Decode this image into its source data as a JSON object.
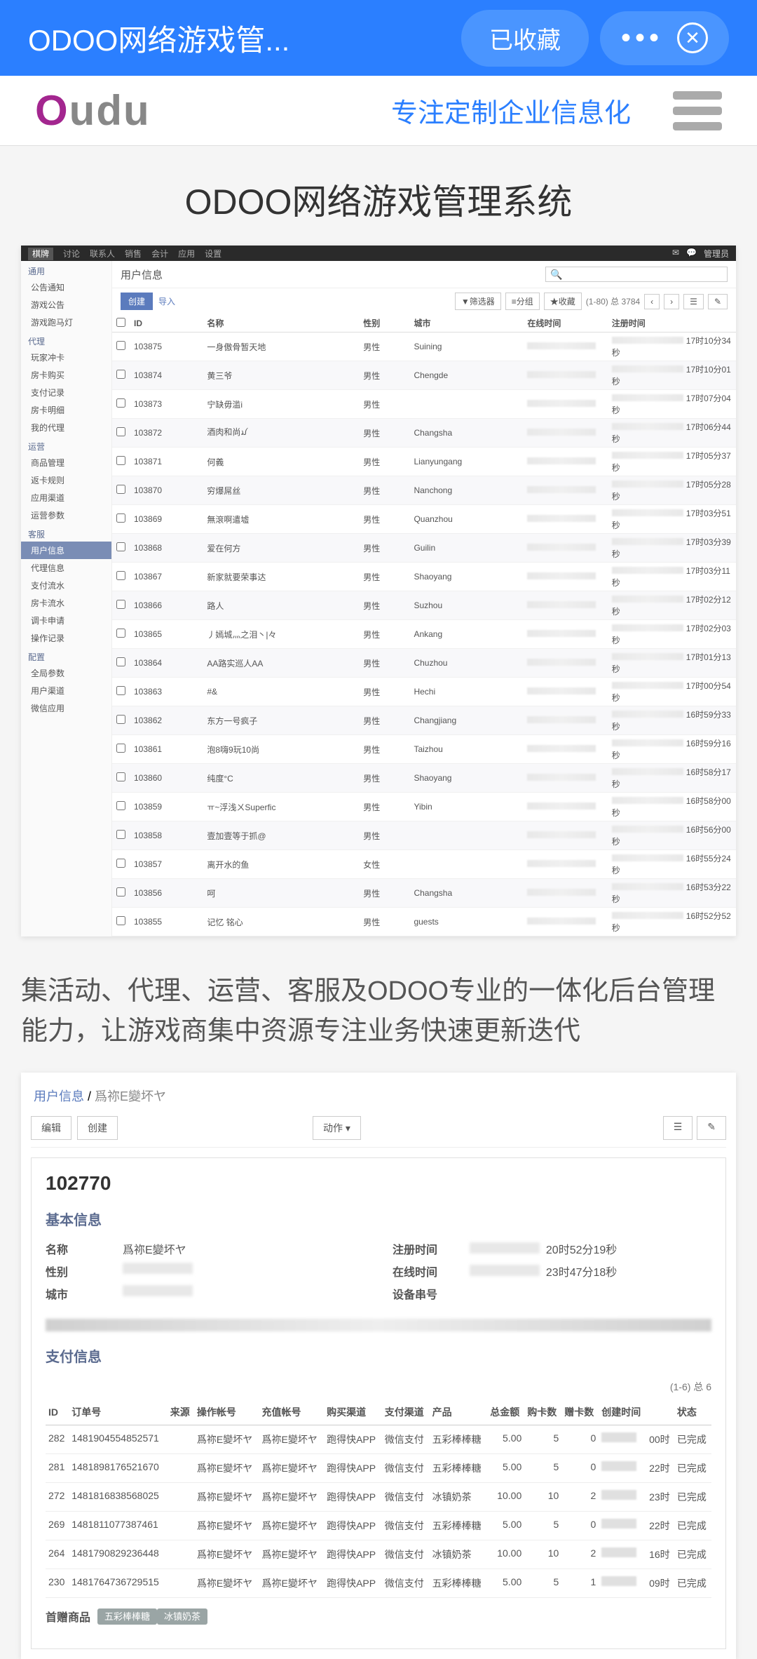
{
  "topbar": {
    "title": "ODOO网络游戏管...",
    "fav": "已收藏"
  },
  "header": {
    "logo1": "O",
    "logo2": "udu",
    "tagline": "专注定制企业信息化"
  },
  "bigTitle": "ODOO网络游戏管理系统",
  "nav": {
    "items": [
      "棋牌",
      "讨论",
      "联系人",
      "销售",
      "会计",
      "应用",
      "设置"
    ],
    "admin": "管理员"
  },
  "sidebar": {
    "groups": [
      {
        "title": "通用",
        "items": [
          "公告通知",
          "游戏公告",
          "游戏跑马灯"
        ]
      },
      {
        "title": "代理",
        "items": [
          "玩家冲卡",
          "房卡购买",
          "支付记录",
          "房卡明细",
          "我的代理"
        ]
      },
      {
        "title": "运营",
        "items": [
          "商品管理",
          "返卡规则",
          "应用渠道",
          "运营参数"
        ]
      },
      {
        "title": "客服",
        "items": [
          "用户信息",
          "代理信息",
          "支付流水",
          "房卡流水",
          "调卡申请",
          "操作记录"
        ]
      },
      {
        "title": "配置",
        "items": [
          "全局参数",
          "用户渠道",
          "微信应用"
        ]
      }
    ],
    "activeItem": "用户信息"
  },
  "listHeader": {
    "breadcrumb": "用户信息",
    "createBtn": "创建",
    "importBtn": "导入",
    "filterBtn": "▼筛选器",
    "groupBtn": "≡分组",
    "favBtn": "★收藏",
    "pager": "(1-80) 总 3784"
  },
  "tableCols": [
    "ID",
    "名称",
    "性别",
    "城市",
    "在线时间",
    "注册时间"
  ],
  "rows": [
    {
      "id": "103875",
      "name": "一身傲骨暂天地",
      "sex": "男性",
      "city": "Suining",
      "reg": "17时10分34秒"
    },
    {
      "id": "103874",
      "name": "黄三爷",
      "sex": "男性",
      "city": "Chengde",
      "reg": "17时10分01秒"
    },
    {
      "id": "103873",
      "name": "宁缺毋滥i",
      "sex": "男性",
      "city": "",
      "reg": "17时07分04秒"
    },
    {
      "id": "103872",
      "name": "酒肉和尚ꪣ",
      "sex": "男性",
      "city": "Changsha",
      "reg": "17时06分44秒"
    },
    {
      "id": "103871",
      "name": "何義",
      "sex": "男性",
      "city": "Lianyungang",
      "reg": "17时05分37秒"
    },
    {
      "id": "103870",
      "name": "穷爆屌丝",
      "sex": "男性",
      "city": "Nanchong",
      "reg": "17时05分28秒"
    },
    {
      "id": "103869",
      "name": "無滾啊遣墟",
      "sex": "男性",
      "city": "Quanzhou",
      "reg": "17时03分51秒"
    },
    {
      "id": "103868",
      "name": "爱在何方",
      "sex": "男性",
      "city": "Guilin",
      "reg": "17时03分39秒"
    },
    {
      "id": "103867",
      "name": "新家就要荣事达",
      "sex": "男性",
      "city": "Shaoyang",
      "reg": "17时03分11秒"
    },
    {
      "id": "103866",
      "name": "路人",
      "sex": "男性",
      "city": "Suzhou",
      "reg": "17时02分12秒"
    },
    {
      "id": "103865",
      "name": "丿嫣城灬之泪丶|々",
      "sex": "男性",
      "city": "Ankang",
      "reg": "17时02分03秒"
    },
    {
      "id": "103864",
      "name": "AA路实巡人AA",
      "sex": "男性",
      "city": "Chuzhou",
      "reg": "17时01分13秒"
    },
    {
      "id": "103863",
      "name": "#&",
      "sex": "男性",
      "city": "Hechi",
      "reg": "17时00分54秒"
    },
    {
      "id": "103862",
      "name": "东方一号疯子",
      "sex": "男性",
      "city": "Changjiang",
      "reg": "16时59分33秒"
    },
    {
      "id": "103861",
      "name": "泡8嗨9玩10尚",
      "sex": "男性",
      "city": "Taizhou",
      "reg": "16时59分16秒"
    },
    {
      "id": "103860",
      "name": "纯度°C",
      "sex": "男性",
      "city": "Shaoyang",
      "reg": "16时58分17秒"
    },
    {
      "id": "103859",
      "name": "ㅠ~浮浅ㄨSuperfic",
      "sex": "男性",
      "city": "Yibin",
      "reg": "16时58分00秒"
    },
    {
      "id": "103858",
      "name": "壹加壹等于抓@",
      "sex": "男性",
      "city": "",
      "reg": "16时56分00秒"
    },
    {
      "id": "103857",
      "name": "离开水的鱼",
      "sex": "女性",
      "city": "",
      "reg": "16时55分24秒"
    },
    {
      "id": "103856",
      "name": "呵",
      "sex": "男性",
      "city": "Changsha",
      "reg": "16时53分22秒"
    },
    {
      "id": "103855",
      "name": "记忆 铭心",
      "sex": "男性",
      "city": "guests",
      "reg": "16时52分52秒"
    }
  ],
  "desc": "集活动、代理、运营、客服及ODOO专业的一体化后台管理能力，让游戏商集中资源专注业务快速更新迭代",
  "detail": {
    "bcLink": "用户信息",
    "bcName": "爲祢E變坏ヤ",
    "editBtn": "编辑",
    "createBtn": "创建",
    "actionBtn": "动作",
    "recordId": "102770",
    "basicTitle": "基本信息",
    "labels": {
      "name": "名称",
      "sex": "性别",
      "city": "城市",
      "regTime": "注册时间",
      "onlineTime": "在线时间",
      "deviceId": "设备串号"
    },
    "vals": {
      "name": "爲祢E變坏ヤ",
      "regTime": "20时52分19秒",
      "onlineTime": "23时47分18秒"
    },
    "payTitle": "支付信息",
    "payCount": "(1-6) 总 6",
    "payCols": [
      "ID",
      "订单号",
      "来源",
      "操作帐号",
      "充值帐号",
      "购买渠道",
      "支付渠道",
      "产品",
      "总金额",
      "购卡数",
      "赠卡数",
      "创建时间",
      "",
      "状态"
    ],
    "payRows": [
      {
        "id": "282",
        "order": "1481904554852571",
        "op": "爲祢E變坏ヤ",
        "charge": "爲祢E變坏ヤ",
        "buy": "跑得快APP",
        "pay": "微信支付",
        "prod": "五彩棒棒糖",
        "amt": "5.00",
        "buyN": "5",
        "giftN": "0",
        "time": "00时",
        "status": "已完成"
      },
      {
        "id": "281",
        "order": "1481898176521670",
        "op": "爲祢E變坏ヤ",
        "charge": "爲祢E變坏ヤ",
        "buy": "跑得快APP",
        "pay": "微信支付",
        "prod": "五彩棒棒糖",
        "amt": "5.00",
        "buyN": "5",
        "giftN": "0",
        "time": "22时",
        "status": "已完成"
      },
      {
        "id": "272",
        "order": "1481816838568025",
        "op": "爲祢E變坏ヤ",
        "charge": "爲祢E變坏ヤ",
        "buy": "跑得快APP",
        "pay": "微信支付",
        "prod": "冰镇奶茶",
        "amt": "10.00",
        "buyN": "10",
        "giftN": "2",
        "time": "23时",
        "status": "已完成"
      },
      {
        "id": "269",
        "order": "1481811077387461",
        "op": "爲祢E變坏ヤ",
        "charge": "爲祢E變坏ヤ",
        "buy": "跑得快APP",
        "pay": "微信支付",
        "prod": "五彩棒棒糖",
        "amt": "5.00",
        "buyN": "5",
        "giftN": "0",
        "time": "22时",
        "status": "已完成"
      },
      {
        "id": "264",
        "order": "1481790829236448",
        "op": "爲祢E變坏ヤ",
        "charge": "爲祢E變坏ヤ",
        "buy": "跑得快APP",
        "pay": "微信支付",
        "prod": "冰镇奶茶",
        "amt": "10.00",
        "buyN": "10",
        "giftN": "2",
        "time": "16时",
        "status": "已完成"
      },
      {
        "id": "230",
        "order": "1481764736729515",
        "op": "爲祢E變坏ヤ",
        "charge": "爲祢E變坏ヤ",
        "buy": "跑得快APP",
        "pay": "微信支付",
        "prod": "五彩棒棒糖",
        "amt": "5.00",
        "buyN": "5",
        "giftN": "1",
        "time": "09时",
        "status": "已完成"
      }
    ],
    "giftLabel": "首赠商品",
    "giftTags": [
      "五彩棒棒糖",
      "冰镇奶茶"
    ]
  }
}
